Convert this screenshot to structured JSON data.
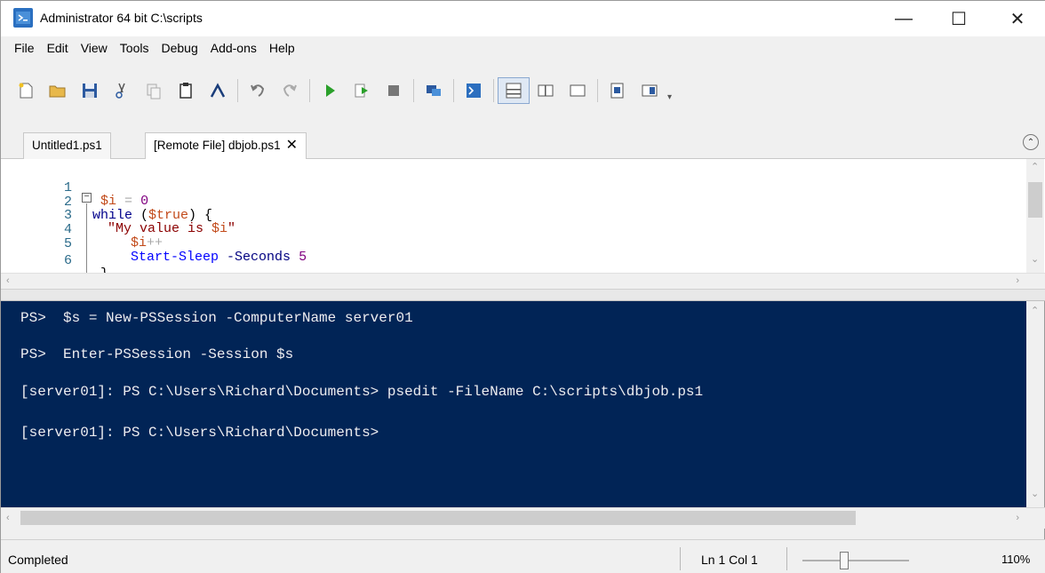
{
  "window": {
    "title": "Administrator 64 bit C:\\scripts",
    "minimize": "—",
    "maximize": "☐",
    "close": "✕"
  },
  "menu": [
    "File",
    "Edit",
    "View",
    "Tools",
    "Debug",
    "Add-ons",
    "Help"
  ],
  "toolbar": {
    "icons": [
      "new-script-icon",
      "open-folder-icon",
      "save-icon",
      "cut-icon",
      "copy-icon",
      "paste-icon",
      "clear-console-icon",
      "undo-icon",
      "redo-icon",
      "run-script-icon",
      "run-selection-icon",
      "stop-icon",
      "new-remote-tab-icon",
      "start-powershell-icon",
      "show-script-top-icon",
      "show-script-right-icon",
      "show-script-maximized-icon",
      "show-command-window-icon",
      "show-command-addon-icon"
    ],
    "more": "▾"
  },
  "tabs": [
    {
      "label": "Untitled1.ps1"
    },
    {
      "label": "[Remote File] dbjob.ps1",
      "close": "✕"
    }
  ],
  "editor": {
    "lines": [
      {
        "num": "1",
        "text": "$i = 0"
      },
      {
        "num": "2",
        "text": "while ($true) {"
      },
      {
        "num": "3",
        "text": "\"My value is $i\""
      },
      {
        "num": "4",
        "text": "$i++"
      },
      {
        "num": "5",
        "text": "Start-Sleep -Seconds 5"
      },
      {
        "num": "6",
        "text": "}"
      }
    ]
  },
  "console": {
    "lines": [
      "PS>  $s = New-PSSession -ComputerName server01",
      "PS>  Enter-PSSession -Session $s",
      "[server01]: PS C:\\Users\\Richard\\Documents> psedit -FileName C:\\scripts\\dbjob.ps1",
      "[server01]: PS C:\\Users\\Richard\\Documents>"
    ]
  },
  "status": {
    "text": "Completed",
    "position": "Ln 1  Col 1",
    "zoom": "110%"
  },
  "colors": {
    "console_bg": "#012456",
    "console_fg": "#eeedf0"
  }
}
